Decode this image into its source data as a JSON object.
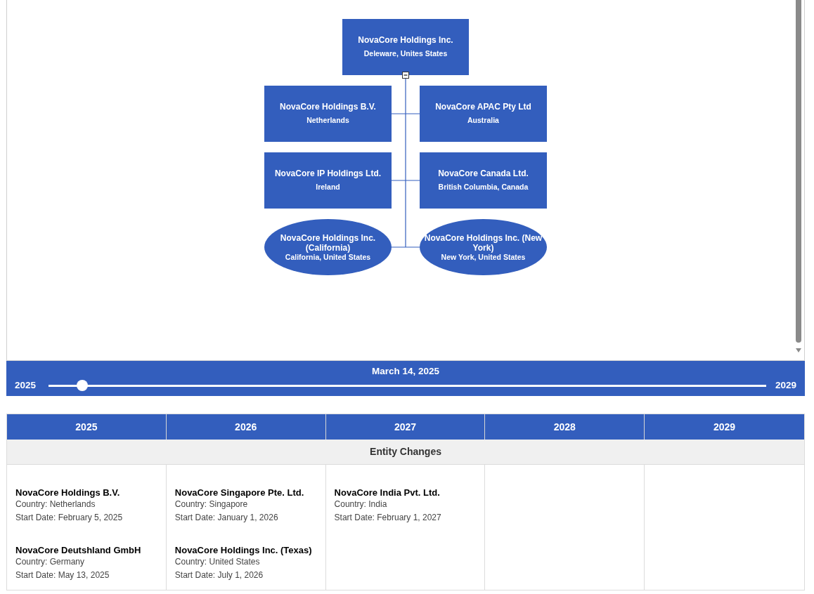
{
  "org_chart": {
    "root": {
      "name": "NovaCore Holdings Inc.",
      "location": "Deleware, Unites States",
      "kind": "rectangle",
      "expanded": true,
      "children": [
        {
          "name": "NovaCore Holdings B.V.",
          "location": "Netherlands",
          "kind": "rectangle"
        },
        {
          "name": "NovaCore APAC Pty Ltd",
          "location": "Australia",
          "kind": "rectangle"
        },
        {
          "name": "NovaCore IP Holdings Ltd.",
          "location": "Ireland",
          "kind": "rectangle"
        },
        {
          "name": "NovaCore Canada Ltd.",
          "location": "British Columbia, Canada",
          "kind": "rectangle"
        },
        {
          "name": "NovaCore Holdings Inc. (California)",
          "location": "California, United States",
          "kind": "ellipse"
        },
        {
          "name": "NovaCore Holdings Inc. (New York)",
          "location": "New York, United States",
          "kind": "ellipse"
        }
      ]
    }
  },
  "timeline": {
    "date": "March 14, 2025",
    "start_label": "2025",
    "end_label": "2029",
    "level": 0.047
  },
  "changes_table": {
    "section_title": "Entity Changes",
    "columns": [
      {
        "year": "2025",
        "entries": [
          {
            "name": "NovaCore Holdings B.V.",
            "country": "Country: Netherlands",
            "start_date": "Start Date: February 5, 2025"
          },
          {
            "name": "NovaCore Deutshland GmbH",
            "country": "Country: Germany",
            "start_date": "Start Date: May 13, 2025"
          }
        ]
      },
      {
        "year": "2026",
        "entries": [
          {
            "name": "NovaCore Singapore Pte. Ltd.",
            "country": "Country: Singapore",
            "start_date": "Start Date: January 1, 2026"
          },
          {
            "name": "NovaCore Holdings Inc. (Texas)",
            "country": "Country: United States",
            "start_date": "Start Date: July 1, 2026"
          }
        ]
      },
      {
        "year": "2027",
        "entries": [
          {
            "name": "NovaCore India Pvt. Ltd.",
            "country": "Country: India",
            "start_date": "Start Date: February 1, 2027"
          }
        ]
      },
      {
        "year": "2028"
      },
      {
        "year": "2029"
      }
    ]
  }
}
